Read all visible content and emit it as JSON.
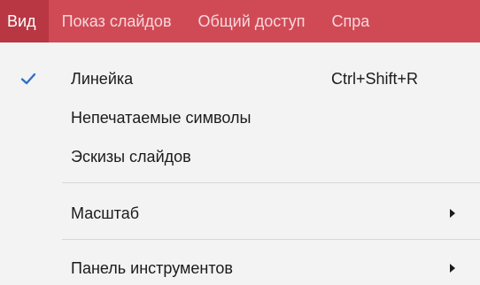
{
  "menubar": {
    "items": [
      {
        "label": "Вид",
        "active": true
      },
      {
        "label": "Показ слайдов",
        "active": false
      },
      {
        "label": "Общий доступ",
        "active": false
      },
      {
        "label": "Спра",
        "active": false
      }
    ]
  },
  "dropdown": {
    "items": [
      {
        "label": "Линейка",
        "shortcut": "Ctrl+Shift+R",
        "checked": true,
        "icon": "checkmark-icon"
      },
      {
        "label": "Непечатаемые символы",
        "shortcut": "",
        "checked": false
      },
      {
        "label": "Эскизы слайдов",
        "shortcut": "",
        "checked": false
      },
      {
        "label": "Масштаб",
        "submenu": true,
        "icon": "submenu-arrow-icon"
      },
      {
        "label": "Панель инструментов",
        "submenu": true,
        "icon": "submenu-arrow-icon"
      }
    ]
  },
  "colors": {
    "menubar_bg": "#d04a56",
    "menubar_active_bg": "#b83743",
    "menubar_text": "#f6d8dc",
    "dropdown_bg": "#f3f3f3",
    "check_color": "#2f6fc6"
  }
}
